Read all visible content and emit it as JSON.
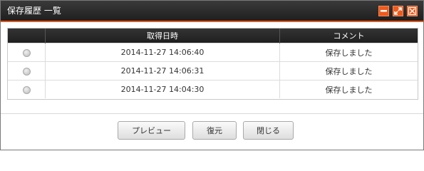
{
  "window": {
    "title": "保存履歴 一覧"
  },
  "table": {
    "headers": [
      "",
      "取得日時",
      "コメント"
    ],
    "rows": [
      {
        "date": "2014-11-27 14:06:40",
        "comment": "保存しました"
      },
      {
        "date": "2014-11-27 14:06:31",
        "comment": "保存しました"
      },
      {
        "date": "2014-11-27 14:04:30",
        "comment": "保存しました"
      }
    ]
  },
  "buttons": {
    "preview": "プレビュー",
    "restore": "復元",
    "close": "閉じる"
  },
  "titlebar_icons": [
    "minimize-icon",
    "maximize-icon",
    "close-icon"
  ],
  "colors": {
    "accent": "#ef5a1c",
    "titlebar": "#2a2a2a",
    "header": "#2a2a2a"
  }
}
